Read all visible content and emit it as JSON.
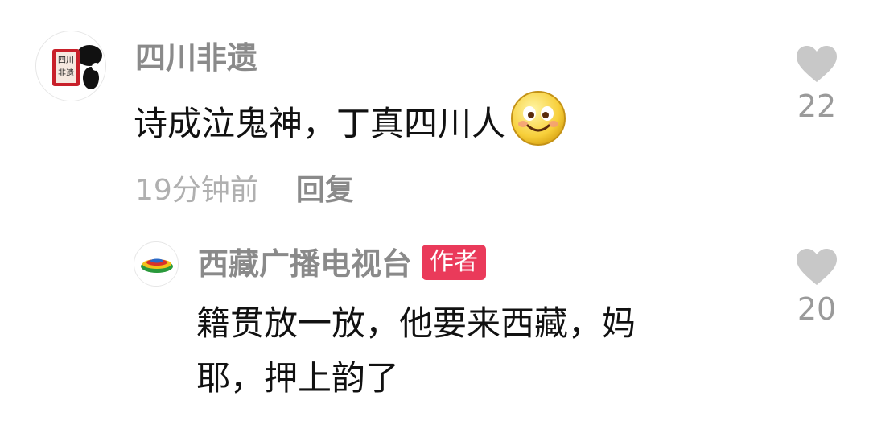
{
  "comments": [
    {
      "username": "四川非遗",
      "avatar_text": "四川非遗",
      "text": "诗成泣鬼神，丁真四川人",
      "emoji": "smile-emoji",
      "time": "19分钟前",
      "reply_label": "回复",
      "likes": "22",
      "like_icon": "heart-icon"
    }
  ],
  "replies": [
    {
      "username": "西藏广播电视台",
      "badge": "作者",
      "text_line1": "籍贯放一放，他要来西藏，妈",
      "text_line2": "耶，押上韵了",
      "likes": "20",
      "like_icon": "heart-icon"
    }
  ],
  "colors": {
    "badge_bg": "#ea3a5a",
    "username": "#8a8a8a",
    "meta": "#b0b0b0",
    "heart": "#c8c8c8"
  }
}
